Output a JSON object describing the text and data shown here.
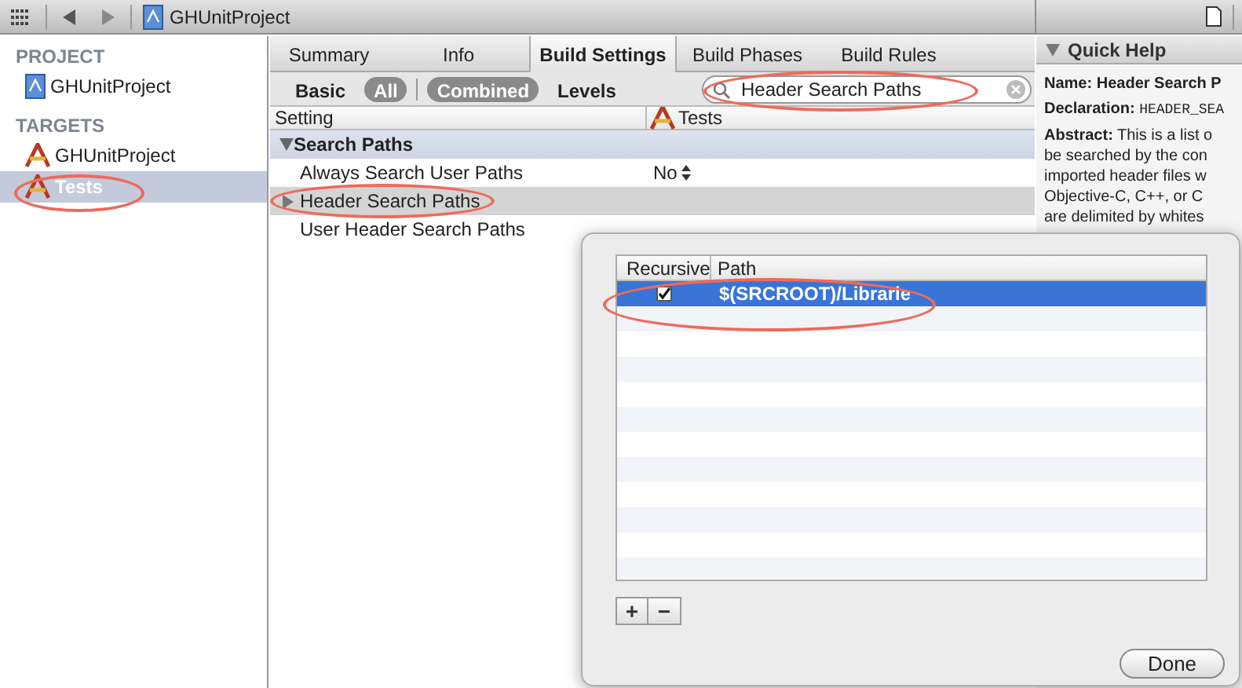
{
  "toolbar": {
    "breadcrumb": "GHUnitProject"
  },
  "sidebar": {
    "sections": [
      {
        "title": "PROJECT",
        "items": [
          {
            "label": "GHUnitProject",
            "kind": "project",
            "selected": false
          }
        ]
      },
      {
        "title": "TARGETS",
        "items": [
          {
            "label": "GHUnitProject",
            "kind": "target",
            "selected": false
          },
          {
            "label": "Tests",
            "kind": "target",
            "selected": true
          }
        ]
      }
    ]
  },
  "tabs": [
    {
      "label": "Summary",
      "selected": false
    },
    {
      "label": "Info",
      "selected": false
    },
    {
      "label": "Build Settings",
      "selected": true
    },
    {
      "label": "Build Phases",
      "selected": false
    },
    {
      "label": "Build Rules",
      "selected": false
    }
  ],
  "filters": [
    {
      "label": "Basic",
      "selected": false
    },
    {
      "label": "All",
      "selected": true
    },
    {
      "label": "Combined",
      "selected": true
    },
    {
      "label": "Levels",
      "selected": false
    }
  ],
  "search": {
    "value": "Header Search Paths"
  },
  "table": {
    "columns": [
      "Setting",
      "Tests"
    ],
    "groups": [
      {
        "title": "Search Paths",
        "expanded": true,
        "rows": [
          {
            "setting": "Always Search User Paths",
            "value": "No",
            "stepper": true,
            "selected": false,
            "disclosure": false
          },
          {
            "setting": "Header Search Paths",
            "stepper": false,
            "selected": true,
            "disclosure": true
          },
          {
            "setting": "User Header Search Paths",
            "stepper": false,
            "selected": false,
            "disclosure": false
          }
        ]
      }
    ]
  },
  "quick_help": {
    "title": "Quick Help",
    "name_label": "Name:",
    "name": "Header Search P",
    "declaration_label": "Declaration:",
    "declaration": "HEADER_SEA",
    "abstract_label": "Abstract:",
    "abstract_lines": [
      "This is a list o",
      "be searched by the con",
      "imported header files w",
      "Objective-C, C++, or C",
      "are delimited by whites"
    ]
  },
  "popover": {
    "columns": [
      "Recursive",
      "Path"
    ],
    "rows": [
      {
        "recursive": true,
        "path": "$(SRCROOT)/Librarie",
        "selected": true
      }
    ],
    "add": "+",
    "remove": "−",
    "done": "Done"
  }
}
